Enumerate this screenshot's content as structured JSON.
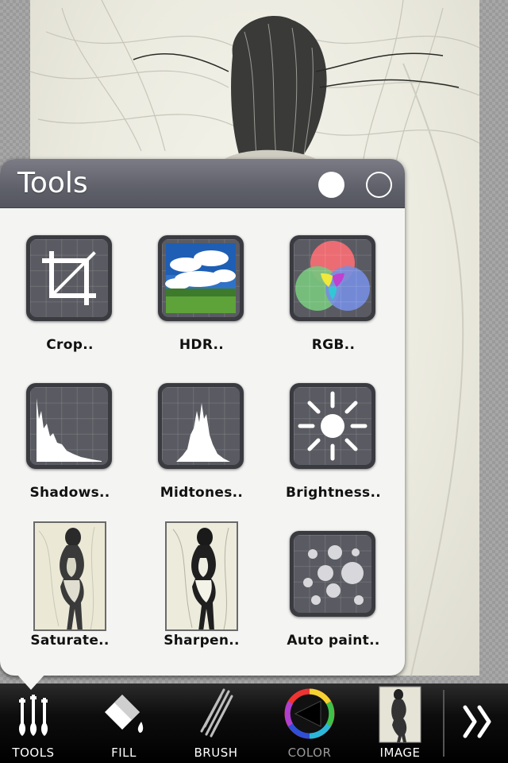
{
  "popup": {
    "title": "Tools",
    "page_indicator": {
      "pages": 2,
      "current": 1
    },
    "tools": [
      {
        "label": "Crop..",
        "icon": "crop-icon"
      },
      {
        "label": "HDR..",
        "icon": "hdr-landscape-icon"
      },
      {
        "label": "RGB..",
        "icon": "rgb-circles-icon"
      },
      {
        "label": "Shadows..",
        "icon": "shadows-histogram-icon"
      },
      {
        "label": "Midtones..",
        "icon": "midtones-histogram-icon"
      },
      {
        "label": "Brightness..",
        "icon": "sun-icon"
      },
      {
        "label": "Saturate..",
        "icon": "saturate-thumbnail"
      },
      {
        "label": "Sharpen..",
        "icon": "sharpen-thumbnail"
      },
      {
        "label": "Auto paint..",
        "icon": "auto-paint-dots-icon"
      }
    ]
  },
  "toolbar": {
    "items": [
      {
        "label": "TOOLS",
        "icon": "tools-brushes-icon",
        "active": true
      },
      {
        "label": "FILL",
        "icon": "fill-bucket-icon",
        "active": false
      },
      {
        "label": "BRUSH",
        "icon": "brush-icon",
        "active": false
      },
      {
        "label": "COLOR",
        "icon": "color-wheel-icon",
        "active": false,
        "dimmed": true
      },
      {
        "label": "IMAGE",
        "icon": "image-thumbnail",
        "active": false
      }
    ],
    "next_icon": "next-chevrons-icon"
  },
  "colors": {
    "header": "#5f606a",
    "popup_bg": "#f4f4f2",
    "toolbar_bg": "#000000"
  }
}
